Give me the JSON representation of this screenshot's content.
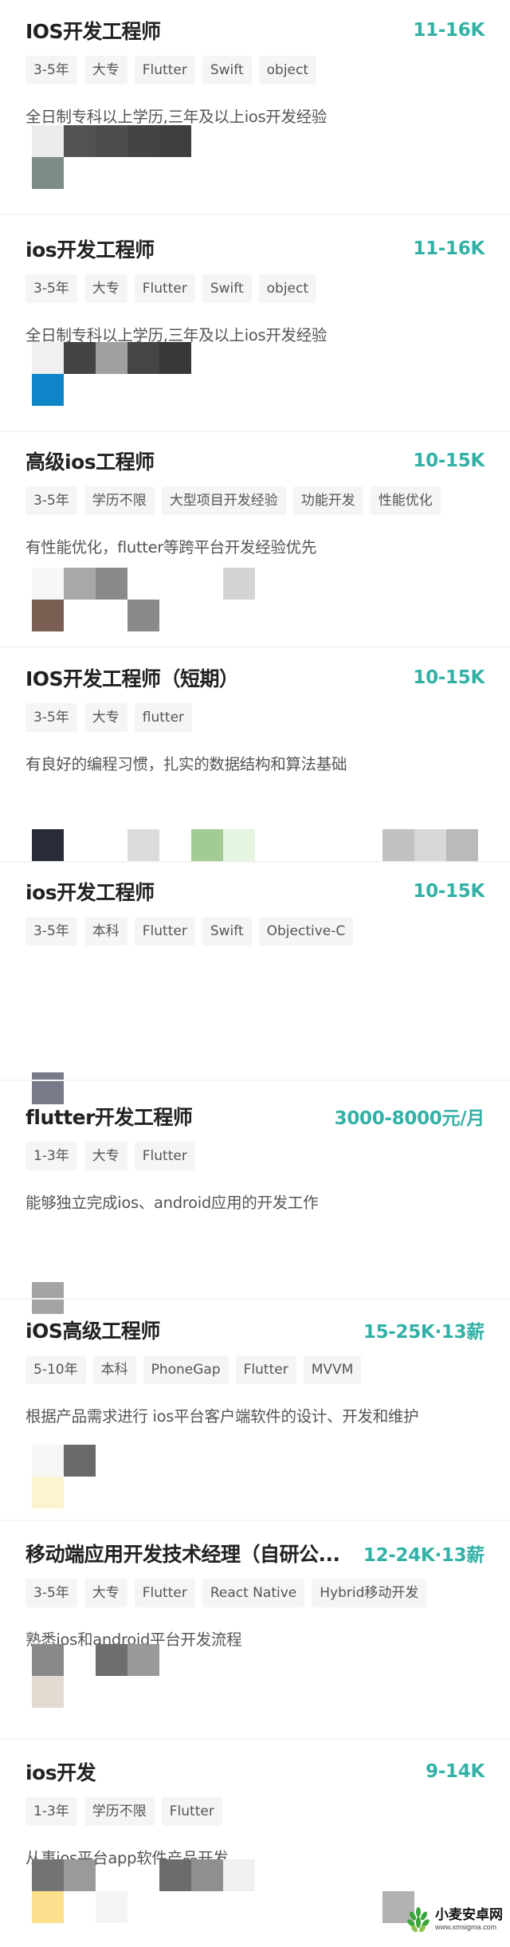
{
  "jobs": [
    {
      "title": "IOS开发工程师",
      "salary": "11-16K",
      "tags": [
        "3-5年",
        "大专",
        "Flutter",
        "Swift",
        "object"
      ],
      "description": "全日制专科以上学历,三年及以上ios开发经验",
      "mosaic_colors": [
        "#ececec",
        "#525252",
        "#4d4d4d",
        "#444444",
        "#3e3e3e",
        "#7c8c86"
      ]
    },
    {
      "title": "ios开发工程师",
      "salary": "11-16K",
      "tags": [
        "3-5年",
        "大专",
        "Flutter",
        "Swift",
        "object"
      ],
      "description": "全日制专科以上学历,三年及以上ios开发经验",
      "mosaic_colors": [
        "#f0f0f0",
        "#444444",
        "#a0a0a0",
        "#454545",
        "#383838",
        "#0e85c8"
      ]
    },
    {
      "title": "高级ios工程师",
      "salary": "10-15K",
      "tags": [
        "3-5年",
        "学历不限",
        "大型项目开发经验",
        "功能开发",
        "性能优化"
      ],
      "description": "有性能优化，flutter等跨平台开发经验优先",
      "mosaic_colors": [
        "#f7f7f7",
        "#a8a8a8",
        "#8a8a8a",
        "#d4d4d4",
        "#7a5e52",
        "#8a8a8a"
      ]
    },
    {
      "title": "IOS开发工程师（短期）",
      "salary": "10-15K",
      "tags": [
        "3-5年",
        "大专",
        "flutter"
      ],
      "description": "有良好的编程习惯，扎实的数据结构和算法基础",
      "mosaic_colors": [
        "#282c38",
        "#dcdcdc",
        "#a2cc94",
        "#e6f4e2",
        "#c2c2c2",
        "#d8d8d8",
        "#bababa"
      ]
    },
    {
      "title": "ios开发工程师",
      "salary": "10-15K",
      "tags": [
        "3-5年",
        "本科",
        "Flutter",
        "Swift",
        "Objective-C"
      ],
      "description": "",
      "mosaic_colors": [
        "#777a89"
      ]
    },
    {
      "title": "flutter开发工程师",
      "salary": "3000-8000元/月",
      "tags": [
        "1-3年",
        "大专",
        "Flutter"
      ],
      "description": "能够独立完成ios、android应用的开发工作",
      "mosaic_colors": [
        "#a4a4a6"
      ]
    },
    {
      "title": "iOS高级工程师",
      "salary": "15-25K·13薪",
      "tags": [
        "5-10年",
        "本科",
        "PhoneGap",
        "Flutter",
        "MVVM"
      ],
      "description": "根据产品需求进行 ios平台客户端软件的设计、开发和维护",
      "mosaic_colors": [
        "#f6f6f6",
        "#6a6a6a",
        "#fdf4cf"
      ]
    },
    {
      "title": "移动端应用开发技术经理（自研公...",
      "salary": "12-24K·13薪",
      "tags": [
        "3-5年",
        "大专",
        "Flutter",
        "React Native",
        "Hybrid移动开发"
      ],
      "description": "熟悉ios和android平台开发流程",
      "mosaic_colors": [
        "#8a8a8a",
        "#6e6e6e",
        "#999999",
        "#e2dbd2"
      ]
    },
    {
      "title": "ios开发",
      "salary": "9-14K",
      "tags": [
        "1-3年",
        "学历不限",
        "Flutter"
      ],
      "description": "从事ios平台app软件产品开发",
      "mosaic_colors": [
        "#737373",
        "#9a9a9a",
        "#6c6c6c",
        "#8f8f8f",
        "#f0f0f0",
        "#fde08e",
        "#f4f4f4",
        "#b2b2b2"
      ]
    }
  ],
  "watermark": {
    "name": "小麦安卓网",
    "url": "www.xmsigma.com"
  },
  "colors": {
    "salary": "#33b1a6",
    "tag_background": "#f5f5f5",
    "title": "#222222",
    "description": "#555555"
  }
}
